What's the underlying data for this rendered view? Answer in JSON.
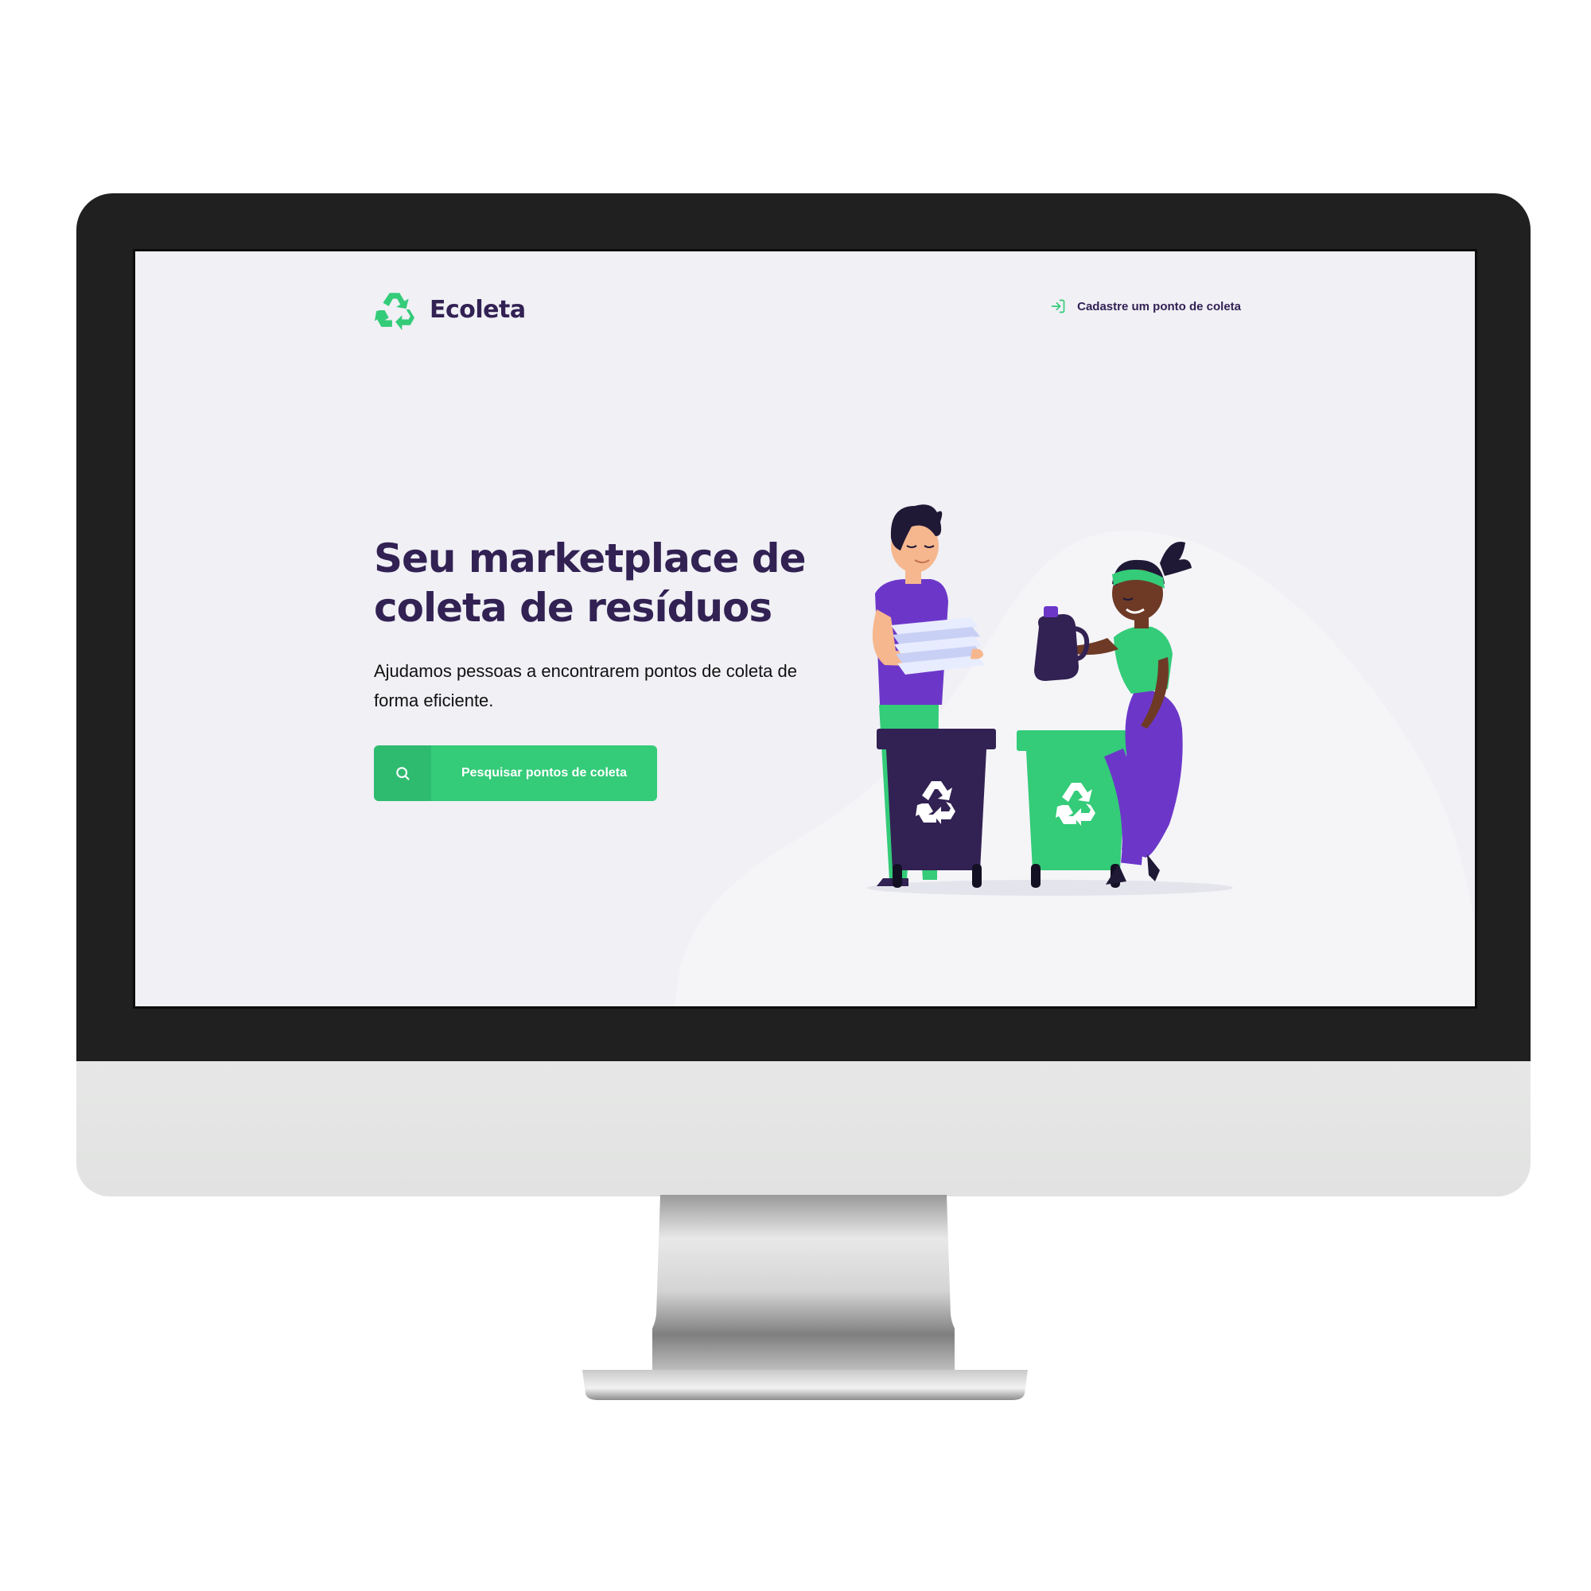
{
  "app": {
    "logo_text": "Ecoleta",
    "logo_icon": "recycle-icon",
    "brand_color": "#34cb79",
    "title_color": "#322153"
  },
  "header": {
    "link_label": "Cadastre um ponto de coleta",
    "link_icon": "log-in-icon"
  },
  "hero": {
    "title": "Seu marketplace de coleta de resíduos",
    "description": "Ajudamos pessoas a encontrarem pontos de coleta de forma eficiente.",
    "button_label": "Pesquisar pontos de coleta",
    "button_icon": "search-icon"
  },
  "illustration": {
    "icon": "people-recycling-illustration"
  }
}
